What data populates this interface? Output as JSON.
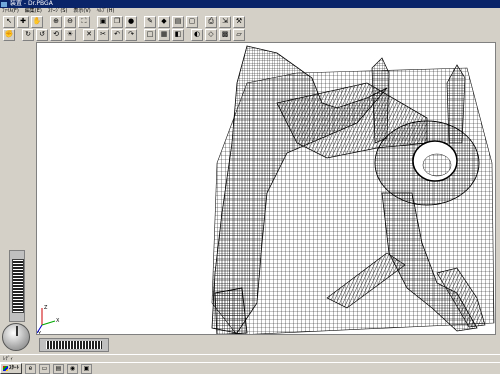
{
  "window": {
    "title": "装置 - Dr.PBGA"
  },
  "menu": [
    "ﾌｧｲﾙ(F)",
    "編集(E)",
    "ｽﾃｰｼﾞ(S)",
    "表示(V)",
    "ﾍﾙﾌﾟ(H)"
  ],
  "toolbar1": [
    {
      "icon": "pointer-icon",
      "glyph": "↖"
    },
    {
      "icon": "move-icon",
      "glyph": "✚"
    },
    {
      "icon": "hand-icon",
      "glyph": "✋"
    },
    {
      "icon": "zoom-in-icon",
      "glyph": "⊕"
    },
    {
      "icon": "zoom-out-icon",
      "glyph": "⊖"
    },
    {
      "icon": "zoom-fit-icon",
      "glyph": "⛶"
    },
    {
      "icon": "select-icon",
      "glyph": "▣"
    },
    {
      "icon": "copy-icon",
      "glyph": "❐"
    },
    {
      "icon": "render-sphere-icon",
      "glyph": "●"
    },
    {
      "icon": "pen-icon",
      "glyph": "✎"
    },
    {
      "icon": "fill-icon",
      "glyph": "◆"
    },
    {
      "icon": "layer-icon",
      "glyph": "▤"
    },
    {
      "icon": "frame-icon",
      "glyph": "▢"
    },
    {
      "icon": "print-icon",
      "glyph": "⎙"
    },
    {
      "icon": "export-icon",
      "glyph": "⇲"
    },
    {
      "icon": "tool-icon",
      "glyph": "⚒"
    }
  ],
  "toolbar2": [
    {
      "icon": "grab-icon",
      "glyph": "✊"
    },
    {
      "icon": "rotate-x-icon",
      "glyph": "↻"
    },
    {
      "icon": "rotate-y-icon",
      "glyph": "↺"
    },
    {
      "icon": "rotate-z-icon",
      "glyph": "⟲"
    },
    {
      "icon": "light-icon",
      "glyph": "☀"
    },
    {
      "icon": "close-view-icon",
      "glyph": "✕"
    },
    {
      "icon": "cut-icon",
      "glyph": "✂"
    },
    {
      "icon": "undo-icon",
      "glyph": "↶"
    },
    {
      "icon": "redo-icon",
      "glyph": "↷"
    },
    {
      "icon": "box-icon",
      "glyph": "□"
    },
    {
      "icon": "grid-icon",
      "glyph": "▦"
    },
    {
      "icon": "cube-icon",
      "glyph": "◧"
    },
    {
      "icon": "shade-icon",
      "glyph": "◐"
    },
    {
      "icon": "wire-icon",
      "glyph": "◇"
    },
    {
      "icon": "mesh-icon",
      "glyph": "▩"
    },
    {
      "icon": "plane-icon",
      "glyph": "▱"
    }
  ],
  "axis": {
    "x": "X",
    "y": "Y",
    "z": "Z"
  },
  "status": {
    "text": "ﾚﾃﾞｨ"
  },
  "taskbar": {
    "start": "ｽﾀｰﾄ"
  },
  "colors": {
    "titlebar": "#0a246a",
    "viewport_bg": "#ffffff",
    "mesh": "#141414"
  }
}
